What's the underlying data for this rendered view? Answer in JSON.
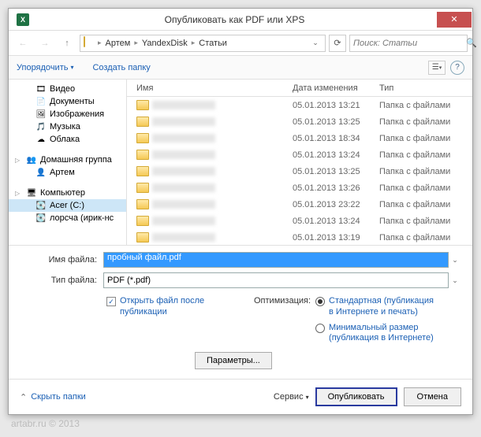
{
  "title": "Опубликовать как PDF или XPS",
  "breadcrumb": {
    "items": [
      "Артем",
      "YandexDisk",
      "Статьи"
    ]
  },
  "search": {
    "placeholder": "Поиск: Статьи"
  },
  "toolbar": {
    "organize": "Упорядочить",
    "new_folder": "Создать папку"
  },
  "sidebar": {
    "items1": [
      {
        "icon": "film",
        "label": "Видео"
      },
      {
        "icon": "doc",
        "label": "Документы"
      },
      {
        "icon": "image",
        "label": "Изображения"
      },
      {
        "icon": "music",
        "label": "Музыка"
      },
      {
        "icon": "cloud",
        "label": "Облака"
      }
    ],
    "homegroup": "Домашняя группа",
    "homegroup_user": "Артем",
    "computer": "Компьютер",
    "drive_c": "Acer (C:)",
    "drive_d": "лорсча (ирик-нс"
  },
  "file_columns": {
    "name": "Имя",
    "date": "Дата изменения",
    "type": "Тип"
  },
  "file_rows": [
    {
      "date": "05.01.2013 13:21",
      "type": "Папка с файлами"
    },
    {
      "date": "05.01.2013 13:25",
      "type": "Папка с файлами"
    },
    {
      "date": "05.01.2013 18:34",
      "type": "Папка с файлами"
    },
    {
      "date": "05.01.2013 13:24",
      "type": "Папка с файлами"
    },
    {
      "date": "05.01.2013 13:25",
      "type": "Папка с файлами"
    },
    {
      "date": "05.01.2013 13:26",
      "type": "Папка с файлами"
    },
    {
      "date": "05.01.2013 23:22",
      "type": "Папка с файлами"
    },
    {
      "date": "05.01.2013 13:24",
      "type": "Папка с файлами"
    },
    {
      "date": "05.01.2013 13:19",
      "type": "Папка с файлами"
    }
  ],
  "fields": {
    "filename_label": "Имя файла:",
    "filename_value": "пробный файл.pdf",
    "filetype_label": "Тип файла:",
    "filetype_value": "PDF (*.pdf)"
  },
  "options": {
    "open_after": "Открыть файл после публикации",
    "optimization_label": "Оптимизация:",
    "opt_standard": "Стандартная (публикация в Интернете и печать)",
    "opt_minimal": "Минимальный размер (публикация в Интернете)",
    "params": "Параметры..."
  },
  "footer": {
    "hide_folders": "Скрыть папки",
    "service": "Сервис",
    "publish": "Опубликовать",
    "cancel": "Отмена"
  },
  "watermark": "artabr.ru © 2013"
}
